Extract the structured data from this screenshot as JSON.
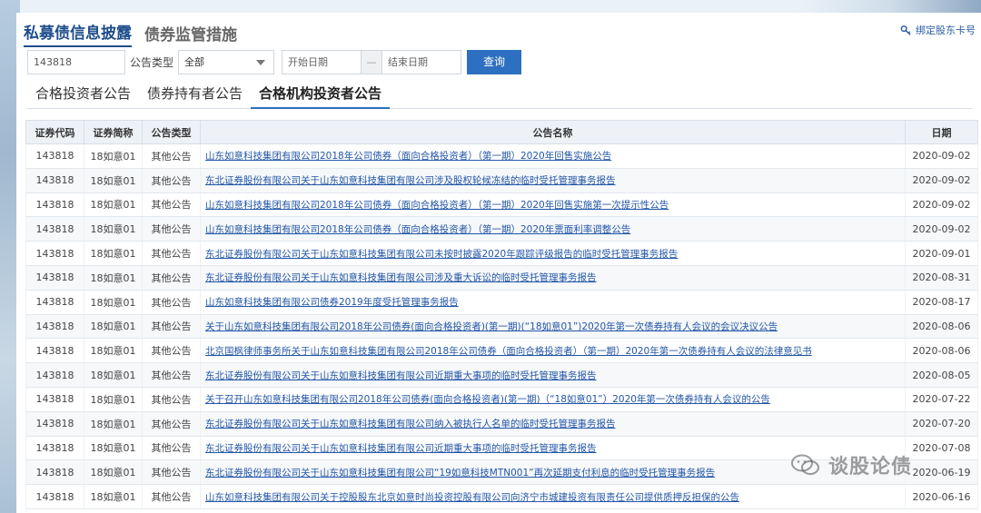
{
  "header": {
    "tabs": [
      {
        "label": "私募债信息披露",
        "active": true
      },
      {
        "label": "债券监管措施",
        "active": false
      }
    ],
    "bind_card_label": "绑定股东卡号"
  },
  "filters": {
    "code_value": "143818",
    "type_label": "公告类型",
    "type_selected": "全部",
    "start_date_placeholder": "开始日期",
    "dash": "—",
    "end_date_placeholder": "结束日期",
    "query_label": "查询"
  },
  "sub_tabs": [
    {
      "label": "合格投资者公告",
      "active": false
    },
    {
      "label": "债券持有者公告",
      "active": false
    },
    {
      "label": "合格机构投资者公告",
      "active": true
    }
  ],
  "table": {
    "headers": [
      "证券代码",
      "证券简称",
      "公告类型",
      "公告名称",
      "日期"
    ],
    "rows": [
      [
        "143818",
        "18如意01",
        "其他公告",
        "山东如意科技集团有限公司2018年公司债券（面向合格投资者）（第一期）2020年回售实施公告",
        "2020-09-02"
      ],
      [
        "143818",
        "18如意01",
        "其他公告",
        "东北证券股份有限公司关于山东如意科技集团有限公司涉及股权轮候冻结的临时受托管理事务报告",
        "2020-09-02"
      ],
      [
        "143818",
        "18如意01",
        "其他公告",
        "山东如意科技集团有限公司2018年公司债券（面向合格投资者）（第一期）2020年回售实施第一次提示性公告",
        "2020-09-02"
      ],
      [
        "143818",
        "18如意01",
        "其他公告",
        "山东如意科技集团有限公司2018年公司债券（面向合格投资者）（第一期）2020年票面利率调整公告",
        "2020-09-02"
      ],
      [
        "143818",
        "18如意01",
        "其他公告",
        "东北证券股份有限公司关于山东如意科技集团有限公司未按时披露2020年跟踪评级报告的临时受托管理事务报告",
        "2020-09-01"
      ],
      [
        "143818",
        "18如意01",
        "其他公告",
        "东北证券股份有限公司关于山东如意科技集团有限公司涉及重大诉讼的临时受托管理事务报告",
        "2020-08-31"
      ],
      [
        "143818",
        "18如意01",
        "其他公告",
        "山东如意科技集团有限公司债券2019年度受托管理事务报告",
        "2020-08-17"
      ],
      [
        "143818",
        "18如意01",
        "其他公告",
        "关于山东如意科技集团有限公司2018年公司债券(面向合格投资者)(第一期)(“18如意01”)2020年第一次债券持有人会议的会议决议公告",
        "2020-08-06"
      ],
      [
        "143818",
        "18如意01",
        "其他公告",
        "北京国枫律师事务所关于山东如意科技集团有限公司2018年公司债券（面向合格投资者）（第一期）2020年第一次债券持有人会议的法律意见书",
        "2020-08-06"
      ],
      [
        "143818",
        "18如意01",
        "其他公告",
        "东北证券股份有限公司关于山东如意科技集团有限公司近期重大事项的临时受托管理事务报告",
        "2020-08-05"
      ],
      [
        "143818",
        "18如意01",
        "其他公告",
        "关于召开山东如意科技集团有限公司2018年公司债券(面向合格投资者)(第一期)（“18如意01”）2020年第一次债券持有人会议的公告",
        "2020-07-22"
      ],
      [
        "143818",
        "18如意01",
        "其他公告",
        "东北证券股份有限公司关于山东如意科技集团有限公司纳入被执行人名单的临时受托管理事务报告",
        "2020-07-20"
      ],
      [
        "143818",
        "18如意01",
        "其他公告",
        "东北证券股份有限公司关于山东如意科技集团有限公司近期重大事项的临时受托管理事务报告",
        "2020-07-08"
      ],
      [
        "143818",
        "18如意01",
        "其他公告",
        "东北证券股份有限公司关于山东如意科技集团有限公司“19如意科技MTN001”再次延期支付利息的临时受托管理事务报告",
        "2020-06-19"
      ],
      [
        "143818",
        "18如意01",
        "其他公告",
        "山东如意科技集团有限公司关于控股股东北京如意时尚投资控股有限公司向济宁市城建投资有限责任公司提供质押反担保的公告",
        "2020-06-16"
      ]
    ]
  },
  "watermark": {
    "text": "谈股论债",
    "icon": "wechat-icon"
  }
}
